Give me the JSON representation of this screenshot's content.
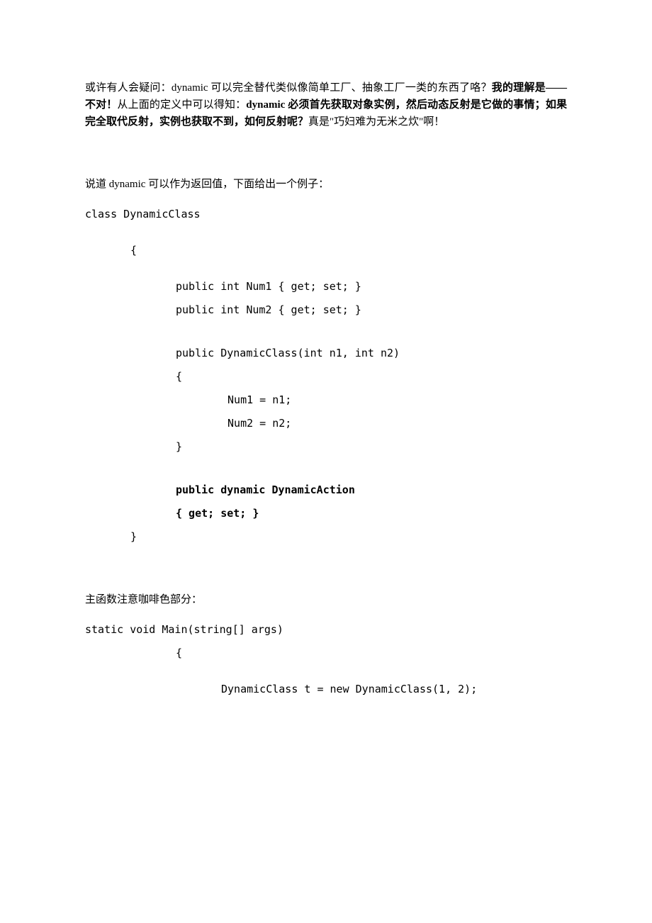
{
  "para1": {
    "pre": "或许有人会疑问：dynamic 可以完全替代类似像简单工厂、抽象工厂一类的东西了咯？",
    "bold1": "我的理解是——不对！",
    "mid1": "从上面的定义中可以得知：",
    "bold2": "dynamic 必须首先获取对象实例，然后动态反射是它做的事情；如果完全取代反射，实例也获取不到，如何反射呢？",
    "tail": "真是\"巧妇难为无米之炊\"啊！"
  },
  "para2": "说道 dynamic 可以作为返回值，下面给出一个例子：",
  "code1": {
    "l1": "class DynamicClass",
    "l2": "{",
    "l3": "public int Num1 { get; set; }",
    "l4": "public int Num2 { get; set; }",
    "l5": "public DynamicClass(int n1, int n2)",
    "l6": "{",
    "l7": " Num1 = n1;",
    "l8": " Num2 = n2;",
    "l9": "}",
    "l10": "public dynamic DynamicAction",
    "l11": "{ get; set; }",
    "l12": "}"
  },
  "para3": "主函数注意咖啡色部分：",
  "code2": {
    "l1": "static void Main(string[] args)",
    "l2": "{",
    "l3": "DynamicClass t = new DynamicClass(1, 2);"
  }
}
